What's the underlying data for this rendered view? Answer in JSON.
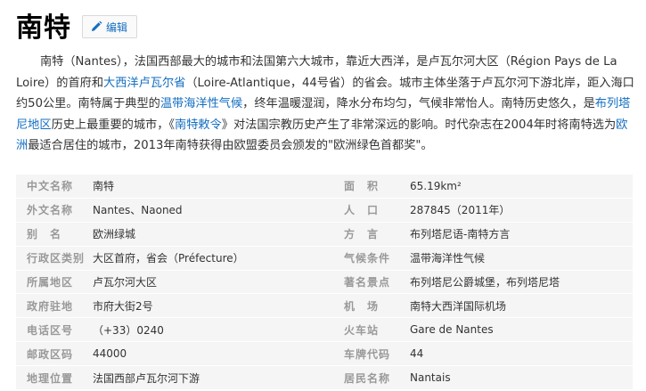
{
  "title": "南特",
  "edit_label": "编辑",
  "summary": {
    "s1": "南特（Nantes），法国西部最大的城市和法国第六大城市，靠近大西洋，是卢瓦尔河大区（Région Pays de La Loire）的首府和",
    "l1": "大西洋卢瓦尔省",
    "s2": "（Loire-Atlantique，44号省）的省会。城市主体坐落于卢瓦尔河下游北岸，距入海口约50公里。南特属于典型的",
    "l2": "温带海洋性气候",
    "s3": "，终年温暖湿润，降水分布均匀，气候非常怡人。南特历史悠久，是",
    "l3": "布列塔尼地区",
    "s4": "历史上最重要的城市，《",
    "l4": "南特敕令",
    "s5": "》对法国宗教历史产生了非常深远的影响。时代杂志在2004年时将南特选为",
    "l5": "欧洲",
    "s6": "最适合居住的城市，2013年南特获得由欧盟委员会颁发的\"欧洲绿色首都奖\"。"
  },
  "infobox": [
    {
      "l1": "中文名称",
      "v1": "南特",
      "l2": "面　积",
      "v2": "65.19km²"
    },
    {
      "l1": "外文名称",
      "v1": "Nantes、Naoned",
      "l2": "人　口",
      "v2": "287845（2011年）"
    },
    {
      "l1": "别　名",
      "v1": "欧洲绿城",
      "l2": "方　言",
      "v2": "布列塔尼语-南特方言"
    },
    {
      "l1": "行政区类别",
      "v1": "大区首府，省会（Préfecture）",
      "l2": "气候条件",
      "v2": "温带海洋性气候"
    },
    {
      "l1": "所属地区",
      "v1": "卢瓦尔河大区",
      "l2": "著名景点",
      "v2": "布列塔尼公爵城堡，布列塔尼塔"
    },
    {
      "l1": "政府驻地",
      "v1": "市府大街2号",
      "l2": "机　场",
      "v2": "南特大西洋国际机场"
    },
    {
      "l1": "电话区号",
      "v1": "（+33）0240",
      "l2": "火车站",
      "v2": "Gare de Nantes"
    },
    {
      "l1": "邮政区码",
      "v1": "44000",
      "l2": "车牌代码",
      "v2": "44"
    },
    {
      "l1": "地理位置",
      "v1": "法国西部卢瓦尔河下游",
      "l2": "居民名称",
      "v2": "Nantais"
    }
  ],
  "icons": {
    "edit": "pencil-icon"
  },
  "colors": {
    "link": "#136ec2",
    "label": "#999999",
    "row_bg": "#f5f5f5"
  }
}
